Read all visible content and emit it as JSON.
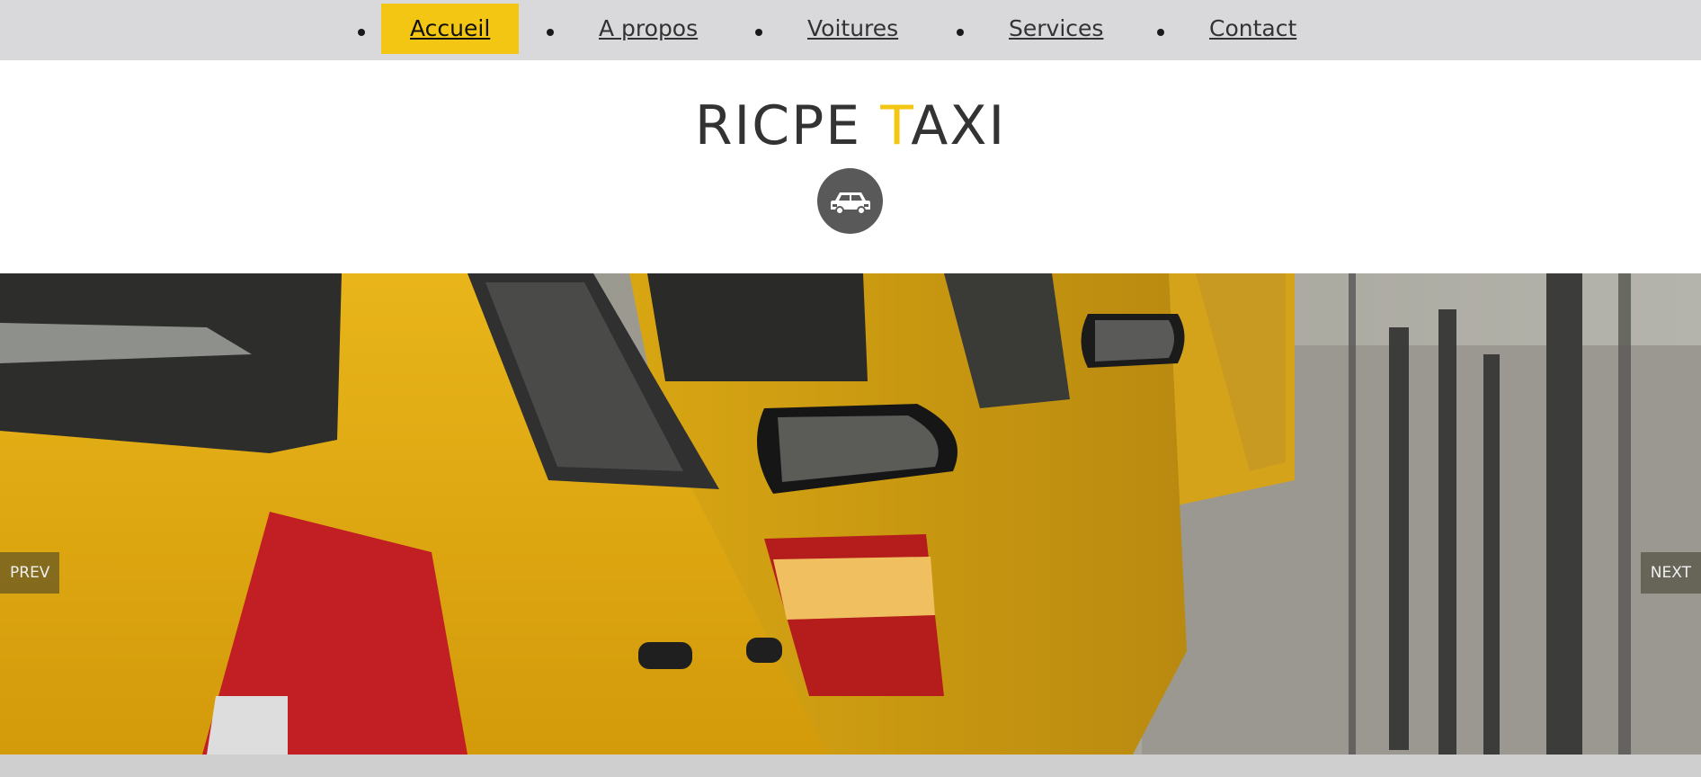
{
  "nav": {
    "items": [
      {
        "label": "Accueil",
        "active": true
      },
      {
        "label": "A propos",
        "active": false
      },
      {
        "label": "Voitures",
        "active": false
      },
      {
        "label": "Services",
        "active": false
      },
      {
        "label": "Contact",
        "active": false
      }
    ]
  },
  "brand": {
    "logo_pre": "RICPE ",
    "logo_accent": "T",
    "logo_post": "AXI",
    "badge_icon": "taxi-car-icon"
  },
  "slider": {
    "prev_label": "PREV",
    "next_label": "NEXT"
  },
  "colors": {
    "accent": "#f3c614",
    "nav_bg": "#d9d9db",
    "badge_bg": "#595959"
  }
}
